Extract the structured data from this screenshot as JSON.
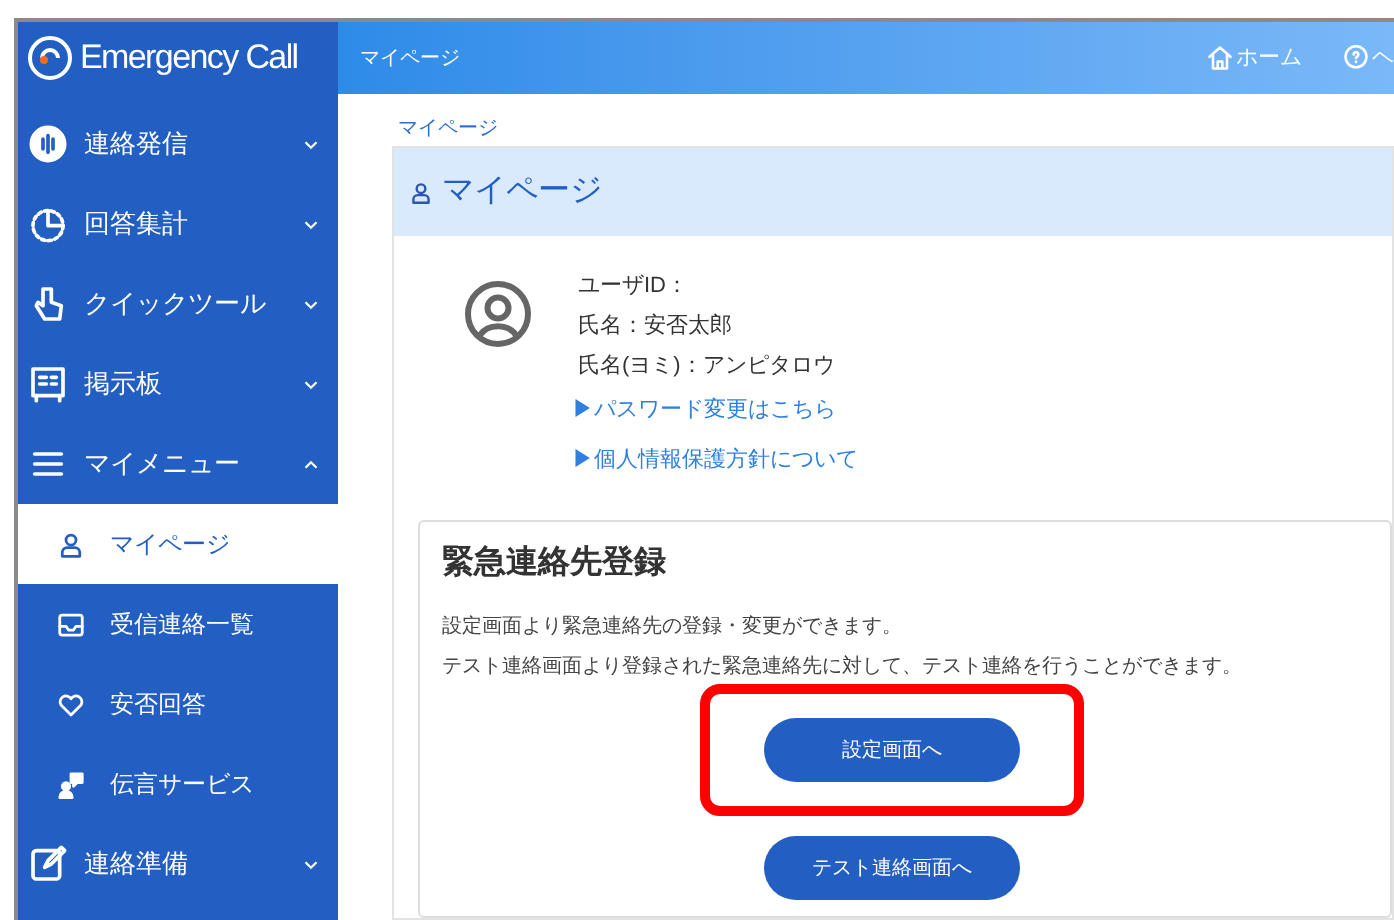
{
  "app": {
    "logo": "Emergency Call"
  },
  "sidebar": {
    "items": [
      {
        "label": "連絡発信",
        "expanded": false
      },
      {
        "label": "回答集計",
        "expanded": false
      },
      {
        "label": "クイックツール",
        "expanded": false
      },
      {
        "label": "掲示板",
        "expanded": false
      },
      {
        "label": "マイメニュー",
        "expanded": true,
        "children": [
          {
            "label": "マイページ",
            "selected": true
          },
          {
            "label": "受信連絡一覧",
            "selected": false
          },
          {
            "label": "安否回答",
            "selected": false
          },
          {
            "label": "伝言サービス",
            "selected": false
          }
        ]
      },
      {
        "label": "連絡準備",
        "expanded": false
      }
    ]
  },
  "top_bar": {
    "title": "マイページ",
    "links": [
      "ホーム",
      "ヘ"
    ]
  },
  "breadcrumb": "マイページ",
  "panel": {
    "title": "マイページ",
    "user_info": [
      "ユーザID：",
      "氏名：安否太郎",
      "氏名(ヨミ)：アンピタロウ"
    ],
    "links": [
      "▶パスワード変更はこちら",
      "▶個人情報保護方針について"
    ]
  },
  "card": {
    "title": "緊急連絡先登録",
    "lines": [
      "設定画面より緊急連絡先の登録・変更ができます。",
      "テスト連絡画面より登録された緊急連絡先に対して、テスト連絡を行うことができます。"
    ],
    "buttons": [
      {
        "label": "設定画面へ",
        "highlighted": true
      },
      {
        "label": "テスト連絡画面へ",
        "highlighted": false
      }
    ]
  }
}
